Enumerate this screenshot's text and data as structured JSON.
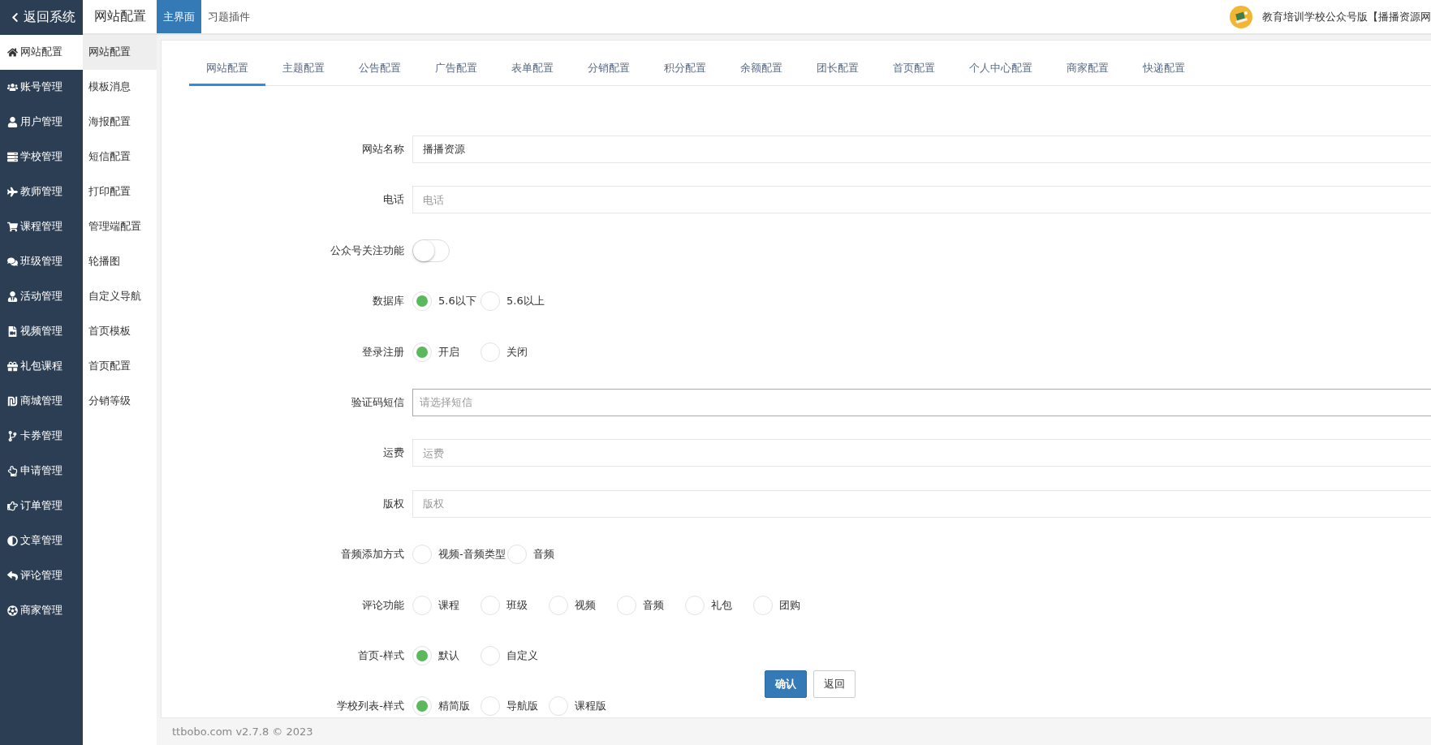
{
  "back_link": {
    "label": "返回系统"
  },
  "header": {
    "title": "网站配置",
    "tabs": [
      {
        "label": "主界面",
        "selected": true
      },
      {
        "label": "习题插件",
        "selected": false
      }
    ],
    "user": "教育培训学校公众号版【播播资源网"
  },
  "sidebar": {
    "items": [
      {
        "label": "网站配置",
        "selected": true
      },
      {
        "label": "账号管理",
        "selected": false
      },
      {
        "label": "用户管理",
        "selected": false
      },
      {
        "label": "学校管理",
        "selected": false
      },
      {
        "label": "教师管理",
        "selected": false
      },
      {
        "label": "课程管理",
        "selected": false
      },
      {
        "label": "班级管理",
        "selected": false
      },
      {
        "label": "活动管理",
        "selected": false
      },
      {
        "label": "视频管理",
        "selected": false
      },
      {
        "label": "礼包课程",
        "selected": false
      },
      {
        "label": "商城管理",
        "selected": false
      },
      {
        "label": "卡券管理",
        "selected": false
      },
      {
        "label": "申请管理",
        "selected": false
      },
      {
        "label": "订单管理",
        "selected": false
      },
      {
        "label": "文章管理",
        "selected": false
      },
      {
        "label": "评论管理",
        "selected": false
      },
      {
        "label": "商家管理",
        "selected": false
      }
    ]
  },
  "submenu": {
    "items": [
      {
        "label": "网站配置",
        "selected": true
      },
      {
        "label": "模板消息",
        "selected": false
      },
      {
        "label": "海报配置",
        "selected": false
      },
      {
        "label": "短信配置",
        "selected": false
      },
      {
        "label": "打印配置",
        "selected": false
      },
      {
        "label": "管理端配置",
        "selected": false
      },
      {
        "label": "轮播图",
        "selected": false
      },
      {
        "label": "自定义导航",
        "selected": false
      },
      {
        "label": "首页模板",
        "selected": false
      },
      {
        "label": "首页配置",
        "selected": false
      },
      {
        "label": "分销等级",
        "selected": false
      }
    ]
  },
  "config_tabs": [
    {
      "label": "网站配置",
      "selected": true
    },
    {
      "label": "主题配置",
      "selected": false
    },
    {
      "label": "公告配置",
      "selected": false
    },
    {
      "label": "广告配置",
      "selected": false
    },
    {
      "label": "表单配置",
      "selected": false
    },
    {
      "label": "分销配置",
      "selected": false
    },
    {
      "label": "积分配置",
      "selected": false
    },
    {
      "label": "余额配置",
      "selected": false
    },
    {
      "label": "团长配置",
      "selected": false
    },
    {
      "label": "首页配置",
      "selected": false
    },
    {
      "label": "个人中心配置",
      "selected": false
    },
    {
      "label": "商家配置",
      "selected": false
    },
    {
      "label": "快递配置",
      "selected": false
    }
  ],
  "form": {
    "fields": [
      {
        "kind": "text",
        "label": "网站名称",
        "value": "播播资源"
      },
      {
        "kind": "text",
        "label": "电话",
        "placeholder": "电话"
      },
      {
        "kind": "switch",
        "label": "公众号关注功能",
        "on": false
      },
      {
        "kind": "radio",
        "label": "数据库",
        "options": [
          {
            "label": "5.6以下",
            "selected": true
          },
          {
            "label": "5.6以上",
            "selected": false
          }
        ]
      },
      {
        "kind": "radio",
        "label": "登录注册",
        "options": [
          {
            "label": "开启",
            "selected": true
          },
          {
            "label": "关闭",
            "selected": false
          }
        ]
      },
      {
        "kind": "select",
        "label": "验证码短信",
        "placeholder": "请选择短信"
      },
      {
        "kind": "text",
        "label": "运费",
        "placeholder": "运费"
      },
      {
        "kind": "text",
        "label": "版权",
        "placeholder": "版权"
      },
      {
        "kind": "radio",
        "label": "音频添加方式",
        "options": [
          {
            "label": "视频-音频类型",
            "selected": false
          },
          {
            "label": "音频",
            "selected": false
          }
        ]
      },
      {
        "kind": "radio",
        "label": "评论功能",
        "options": [
          {
            "label": "课程",
            "selected": false
          },
          {
            "label": "班级",
            "selected": false
          },
          {
            "label": "视频",
            "selected": false
          },
          {
            "label": "音频",
            "selected": false
          },
          {
            "label": "礼包",
            "selected": false
          },
          {
            "label": "团购",
            "selected": false
          }
        ]
      },
      {
        "kind": "radio",
        "label": "首页-样式",
        "options": [
          {
            "label": "默认",
            "selected": true
          },
          {
            "label": "自定义",
            "selected": false
          }
        ]
      },
      {
        "kind": "radio",
        "label": "学校列表-样式",
        "options": [
          {
            "label": "精简版",
            "selected": true
          },
          {
            "label": "导航版",
            "selected": false
          },
          {
            "label": "课程版",
            "selected": false
          }
        ]
      }
    ]
  },
  "actions": [
    {
      "kind": "primary",
      "label": "确认"
    },
    {
      "kind": "default",
      "label": "返回"
    }
  ],
  "footer": "ttbobo.com v2.7.8 © 2023"
}
